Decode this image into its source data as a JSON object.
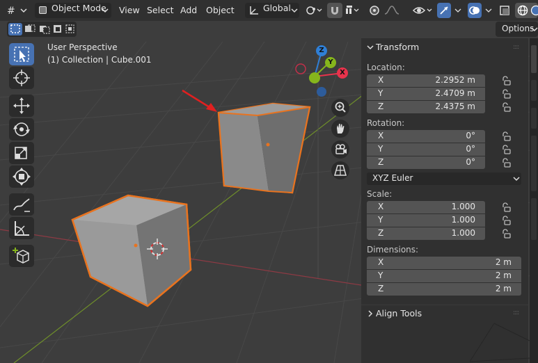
{
  "header": {
    "mode_label": "Object Mode",
    "menu": [
      "View",
      "Select",
      "Add",
      "Object"
    ],
    "orientation_label": "Global",
    "options_label": "Options"
  },
  "viewport": {
    "perspective": "User Perspective",
    "collection": "(1) Collection | Cube.001",
    "gizmo": {
      "z": "Z",
      "y": "Y",
      "x": "X"
    }
  },
  "npanel": {
    "transform_title": "Transform",
    "location_label": "Location:",
    "location": [
      {
        "axis": "X",
        "value": "2.2952 m"
      },
      {
        "axis": "Y",
        "value": "2.4709 m"
      },
      {
        "axis": "Z",
        "value": "2.4375 m"
      }
    ],
    "rotation_label": "Rotation:",
    "rotation": [
      {
        "axis": "X",
        "value": "0°"
      },
      {
        "axis": "Y",
        "value": "0°"
      },
      {
        "axis": "Z",
        "value": "0°"
      }
    ],
    "rotation_mode": "XYZ Euler",
    "scale_label": "Scale:",
    "scale": [
      {
        "axis": "X",
        "value": "1.000"
      },
      {
        "axis": "Y",
        "value": "1.000"
      },
      {
        "axis": "Z",
        "value": "1.000"
      }
    ],
    "dimensions_label": "Dimensions:",
    "dimensions": [
      {
        "axis": "X",
        "value": "2 m"
      },
      {
        "axis": "Y",
        "value": "2 m"
      },
      {
        "axis": "Z",
        "value": "2 m"
      }
    ],
    "align_tools_title": "Align Tools"
  },
  "colors": {
    "selection_outline": "#e8731f",
    "active_tool": "#4772b3",
    "x_axis": "#e8334c",
    "y_axis": "#86b61c",
    "z_axis": "#2f7fd6",
    "arrow": "#e02020"
  }
}
